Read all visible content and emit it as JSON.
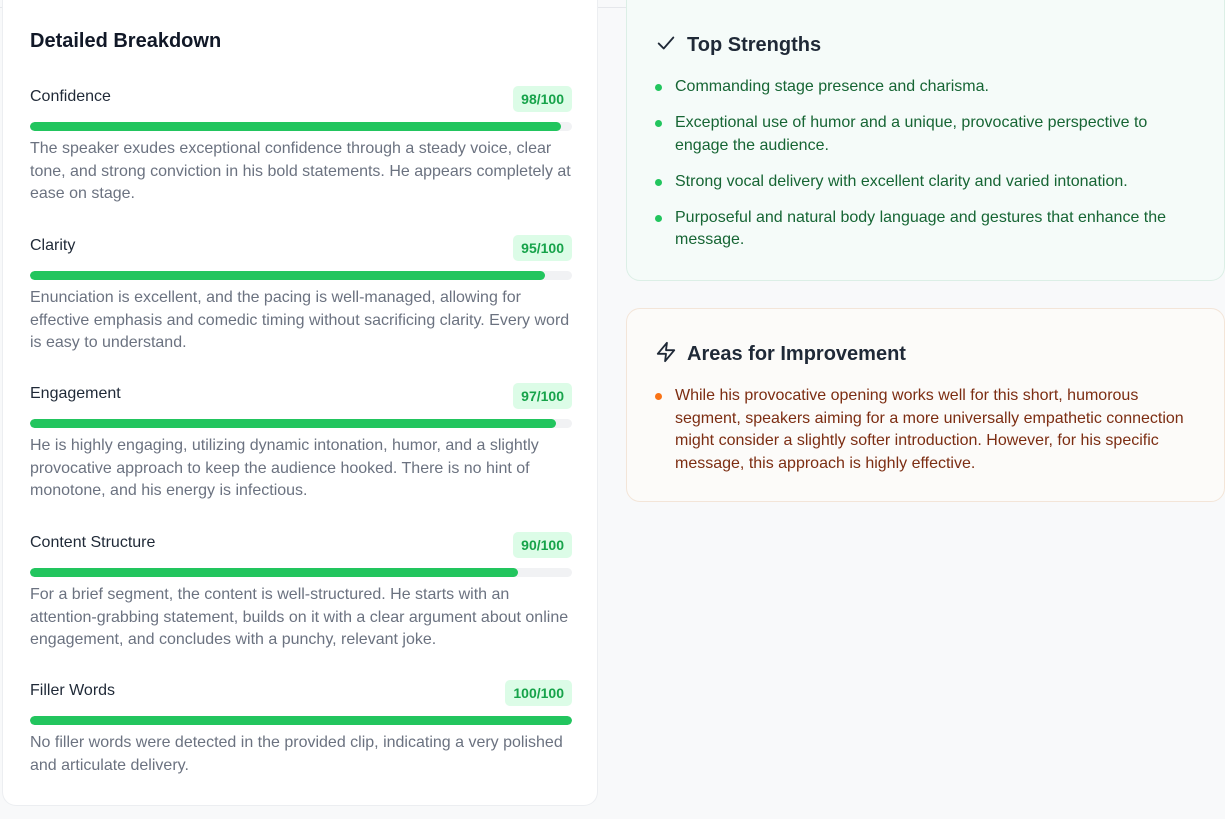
{
  "breakdown": {
    "title": "Detailed Breakdown",
    "metrics": [
      {
        "name": "Confidence",
        "score_label": "98/100",
        "score": 98,
        "description": "The speaker exudes exceptional confidence through a steady voice, clear tone, and strong conviction in his bold statements. He appears completely at ease on stage."
      },
      {
        "name": "Clarity",
        "score_label": "95/100",
        "score": 95,
        "description": "Enunciation is excellent, and the pacing is well-managed, allowing for effective emphasis and comedic timing without sacrificing clarity. Every word is easy to understand."
      },
      {
        "name": "Engagement",
        "score_label": "97/100",
        "score": 97,
        "description": "He is highly engaging, utilizing dynamic intonation, humor, and a slightly provocative approach to keep the audience hooked. There is no hint of monotone, and his energy is infectious."
      },
      {
        "name": "Content Structure",
        "score_label": "90/100",
        "score": 90,
        "description": "For a brief segment, the content is well-structured. He starts with an attention-grabbing statement, builds on it with a clear argument about online engagement, and concludes with a punchy, relevant joke."
      },
      {
        "name": "Filler Words",
        "score_label": "100/100",
        "score": 100,
        "description": "No filler words were detected in the provided clip, indicating a very polished and articulate delivery."
      }
    ]
  },
  "strengths": {
    "icon": "check-icon",
    "title": "Top Strengths",
    "items": [
      "Commanding stage presence and charisma.",
      "Exceptional use of humor and a unique, provocative perspective to engage the audience.",
      "Strong vocal delivery with excellent clarity and varied intonation.",
      "Purposeful and natural body language and gestures that enhance the message."
    ]
  },
  "improvement": {
    "icon": "lightning-icon",
    "title": "Areas for Improvement",
    "items": [
      "While his provocative opening works well for this short, humorous segment, speakers aiming for a more universally empathetic connection might consider a slightly softer introduction. However, for his specific message, this approach is highly effective."
    ]
  },
  "colors": {
    "progress": "#22c55e",
    "badge_bg": "#dcfce7",
    "badge_text": "#16a34a",
    "strength_text": "#166534",
    "improve_text": "#7c2d12",
    "improve_dot": "#f97316"
  }
}
